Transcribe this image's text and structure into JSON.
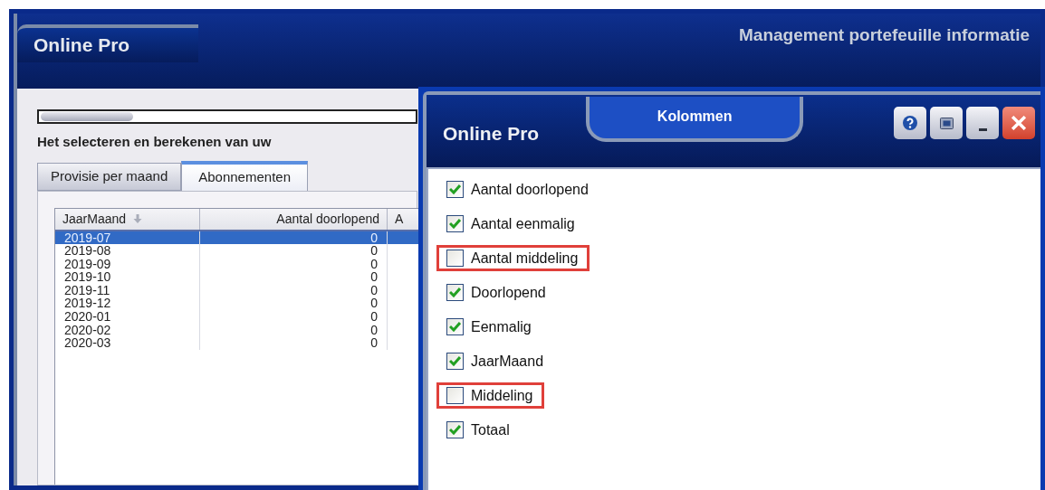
{
  "window": {
    "title": "Online Pro",
    "subtitle": "Management portefeuille informatie"
  },
  "intro": "Het selecteren en berekenen van uw",
  "tabs": [
    {
      "label": "Provisie per maand",
      "selected": false
    },
    {
      "label": "Abonnementen",
      "selected": true
    }
  ],
  "table": {
    "columns": [
      {
        "label": "JaarMaand",
        "sorted": true
      },
      {
        "label": "Aantal doorlopend",
        "sorted": false
      },
      {
        "label": "A",
        "sorted": false
      }
    ],
    "rows": [
      {
        "cells": [
          "2019-07",
          "0"
        ],
        "selected": true
      },
      {
        "cells": [
          "2019-08",
          "0"
        ],
        "selected": false
      },
      {
        "cells": [
          "2019-09",
          "0"
        ],
        "selected": false
      },
      {
        "cells": [
          "2019-10",
          "0"
        ],
        "selected": false
      },
      {
        "cells": [
          "2019-11",
          "0"
        ],
        "selected": false
      },
      {
        "cells": [
          "2019-12",
          "0"
        ],
        "selected": false
      },
      {
        "cells": [
          "2020-01",
          "0"
        ],
        "selected": false
      },
      {
        "cells": [
          "2020-02",
          "0"
        ],
        "selected": false
      },
      {
        "cells": [
          "2020-03",
          "0"
        ],
        "selected": false
      }
    ]
  },
  "dialog": {
    "app": "Online Pro",
    "title": "Kolommen",
    "buttons": [
      {
        "kind": "help"
      },
      {
        "kind": "screenshot"
      },
      {
        "kind": "minimize"
      },
      {
        "kind": "close"
      }
    ],
    "items": [
      {
        "label": "Aantal doorlopend",
        "checked": true,
        "highlighted": false
      },
      {
        "label": "Aantal eenmalig",
        "checked": true,
        "highlighted": false
      },
      {
        "label": "Aantal middeling",
        "checked": false,
        "highlighted": true
      },
      {
        "label": "Doorlopend",
        "checked": true,
        "highlighted": false
      },
      {
        "label": "Eenmalig",
        "checked": true,
        "highlighted": false
      },
      {
        "label": "JaarMaand",
        "checked": true,
        "highlighted": false
      },
      {
        "label": "Middeling",
        "checked": false,
        "highlighted": true
      },
      {
        "label": "Totaal",
        "checked": true,
        "highlighted": false
      }
    ]
  }
}
